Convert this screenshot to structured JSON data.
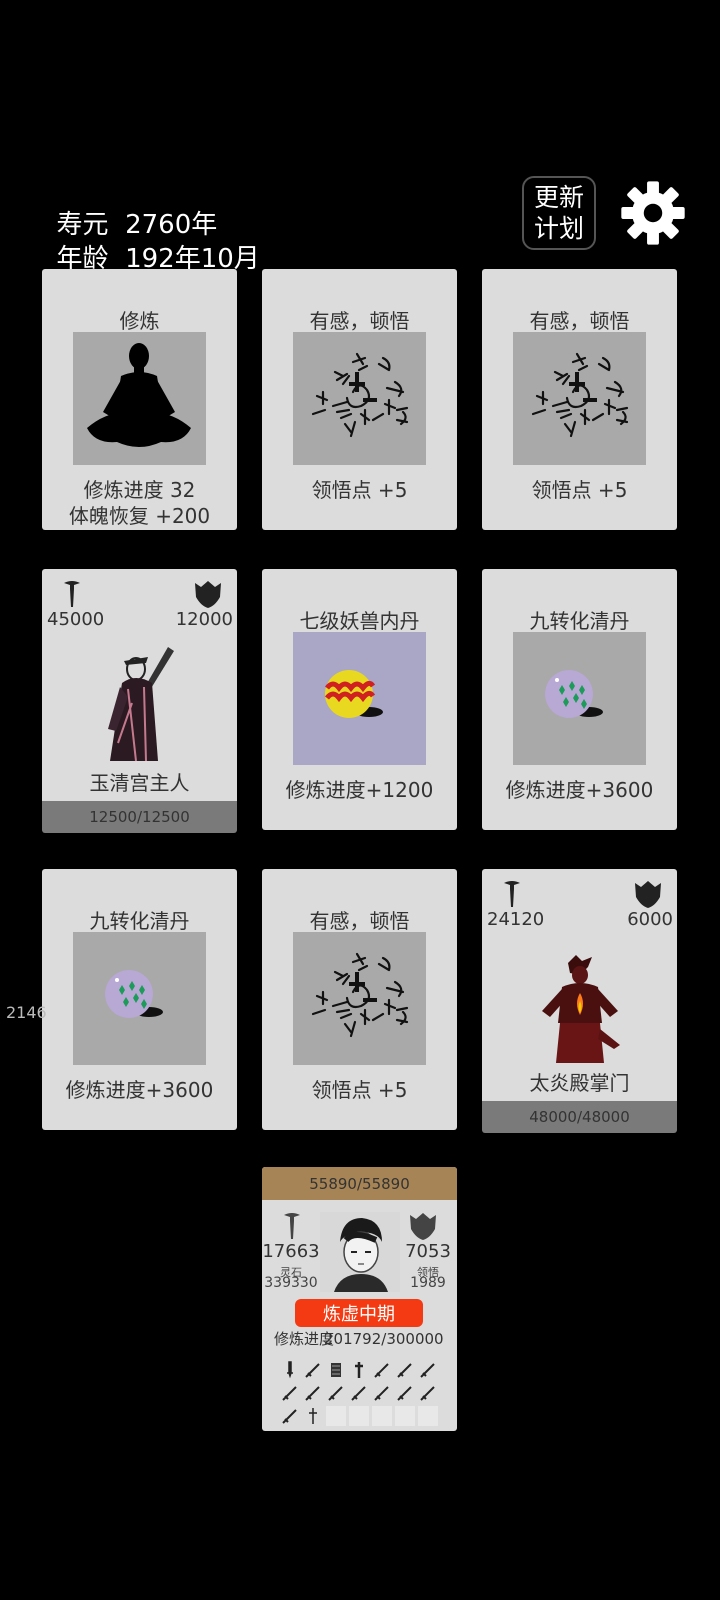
{
  "header": {
    "lifespan_label": "寿元",
    "lifespan_value": "2760年",
    "age_label": "年龄",
    "age_value": "192年10月",
    "update_plan_line1": "更新",
    "update_plan_line2": "计划"
  },
  "cards": {
    "cultivate": {
      "title": "修炼",
      "line1": "修炼进度  32",
      "line2": "体魄恢复  +200"
    },
    "insight_1": {
      "title": "有感，顿悟",
      "line1": "领悟点  +5"
    },
    "insight_2": {
      "title": "有感，顿悟",
      "line1": "领悟点  +5"
    },
    "enemy_1": {
      "atk": "45000",
      "def": "12000",
      "name": "玉清宫主人",
      "hp": "12500/12500"
    },
    "beast_core": {
      "title": "七级妖兽内丹",
      "line1": "修炼进度+1200"
    },
    "pill_1": {
      "title": "九转化清丹",
      "line1": "修炼进度+3600"
    },
    "pill_2": {
      "title": "九转化清丹",
      "line1": "修炼进度+3600"
    },
    "insight_3": {
      "title": "有感，顿悟",
      "line1": "领悟点  +5"
    },
    "enemy_2": {
      "atk": "24120",
      "def": "6000",
      "name": "太炎殿掌门",
      "hp": "48000/48000"
    }
  },
  "side_number": "2146",
  "player": {
    "hp": "55890/55890",
    "atk": "17663",
    "def": "7053",
    "spirit_stone_label": "灵石",
    "spirit_stone_value": "339330",
    "insight_label": "领悟",
    "insight_value": "1989",
    "realm": "炼虚中期",
    "progress_label": "修炼进度",
    "progress_value": "201792/300000",
    "inventory_icons": [
      "dagger-icon",
      "sword-icon",
      "scroll-icon",
      "blade-icon",
      "sword-icon",
      "sword-icon",
      "sword-icon",
      "sword-icon",
      "sword-icon",
      "sword-icon",
      "sword-icon",
      "sword-icon",
      "sword-icon",
      "sword-icon",
      "sword-icon",
      "dagger-icon"
    ]
  },
  "colors": {
    "card_bg": "#dcdcdc",
    "image_bg": "#a9a9a9",
    "realm_badge": "#f33a12",
    "player_hp_bar": "#a78456",
    "enemy_hp_bar": "#7a7a7a"
  }
}
